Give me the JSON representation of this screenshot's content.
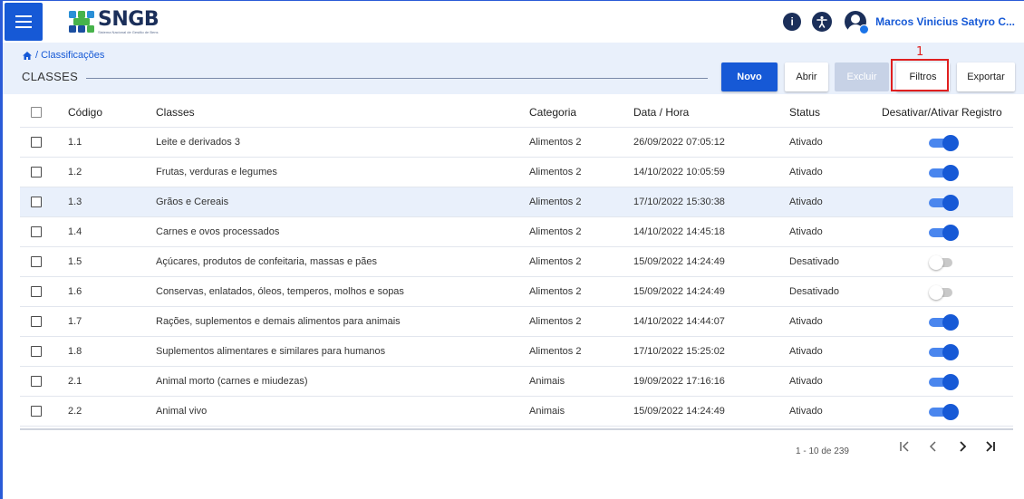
{
  "app": {
    "logo_title": "SNGB",
    "logo_subtitle": "Sistema Nacional de Gestão de Bens",
    "user_name": "Marcos Vinicius Satyro C..."
  },
  "breadcrumb": "/ Classificações",
  "page_title": "CLASSES",
  "toolbar": {
    "novo": "Novo",
    "abrir": "Abrir",
    "excluir": "Excluir",
    "filtros": "Filtros",
    "exportar": "Exportar"
  },
  "annotation_number": "1",
  "table": {
    "headers": {
      "code": "Código",
      "class": "Classes",
      "category": "Categoria",
      "date": "Data / Hora",
      "status": "Status",
      "toggle": "Desativar/Ativar Registro"
    },
    "rows": [
      {
        "code": "1.1",
        "class": "Leite e derivados 3",
        "category": "Alimentos 2",
        "date": "26/09/2022 07:05:12",
        "status": "Ativado",
        "active": true
      },
      {
        "code": "1.2",
        "class": "Frutas, verduras e legumes",
        "category": "Alimentos 2",
        "date": "14/10/2022 10:05:59",
        "status": "Ativado",
        "active": true
      },
      {
        "code": "1.3",
        "class": "Grãos e Cereais",
        "category": "Alimentos 2",
        "date": "17/10/2022 15:30:38",
        "status": "Ativado",
        "active": true
      },
      {
        "code": "1.4",
        "class": "Carnes e ovos processados",
        "category": "Alimentos 2",
        "date": "14/10/2022 14:45:18",
        "status": "Ativado",
        "active": true
      },
      {
        "code": "1.5",
        "class": "Açúcares, produtos de confeitaria, massas e pães",
        "category": "Alimentos 2",
        "date": "15/09/2022 14:24:49",
        "status": "Desativado",
        "active": false
      },
      {
        "code": "1.6",
        "class": "Conservas, enlatados, óleos, temperos, molhos e sopas",
        "category": "Alimentos 2",
        "date": "15/09/2022 14:24:49",
        "status": "Desativado",
        "active": false
      },
      {
        "code": "1.7",
        "class": "Rações, suplementos e demais alimentos para animais",
        "category": "Alimentos 2",
        "date": "14/10/2022 14:44:07",
        "status": "Ativado",
        "active": true
      },
      {
        "code": "1.8",
        "class": "Suplementos alimentares e similares para humanos",
        "category": "Alimentos 2",
        "date": "17/10/2022 15:25:02",
        "status": "Ativado",
        "active": true
      },
      {
        "code": "2.1",
        "class": "Animal morto (carnes e miudezas)",
        "category": "Animais",
        "date": "19/09/2022 17:16:16",
        "status": "Ativado",
        "active": true
      },
      {
        "code": "2.2",
        "class": "Animal vivo",
        "category": "Animais",
        "date": "15/09/2022 14:24:49",
        "status": "Ativado",
        "active": true
      }
    ]
  },
  "pagination": {
    "range": "1 - 10 de 239"
  },
  "colors": {
    "primary": "#1659d6",
    "header_bg": "#e9f0fb",
    "highlight": "#e01f1f"
  }
}
